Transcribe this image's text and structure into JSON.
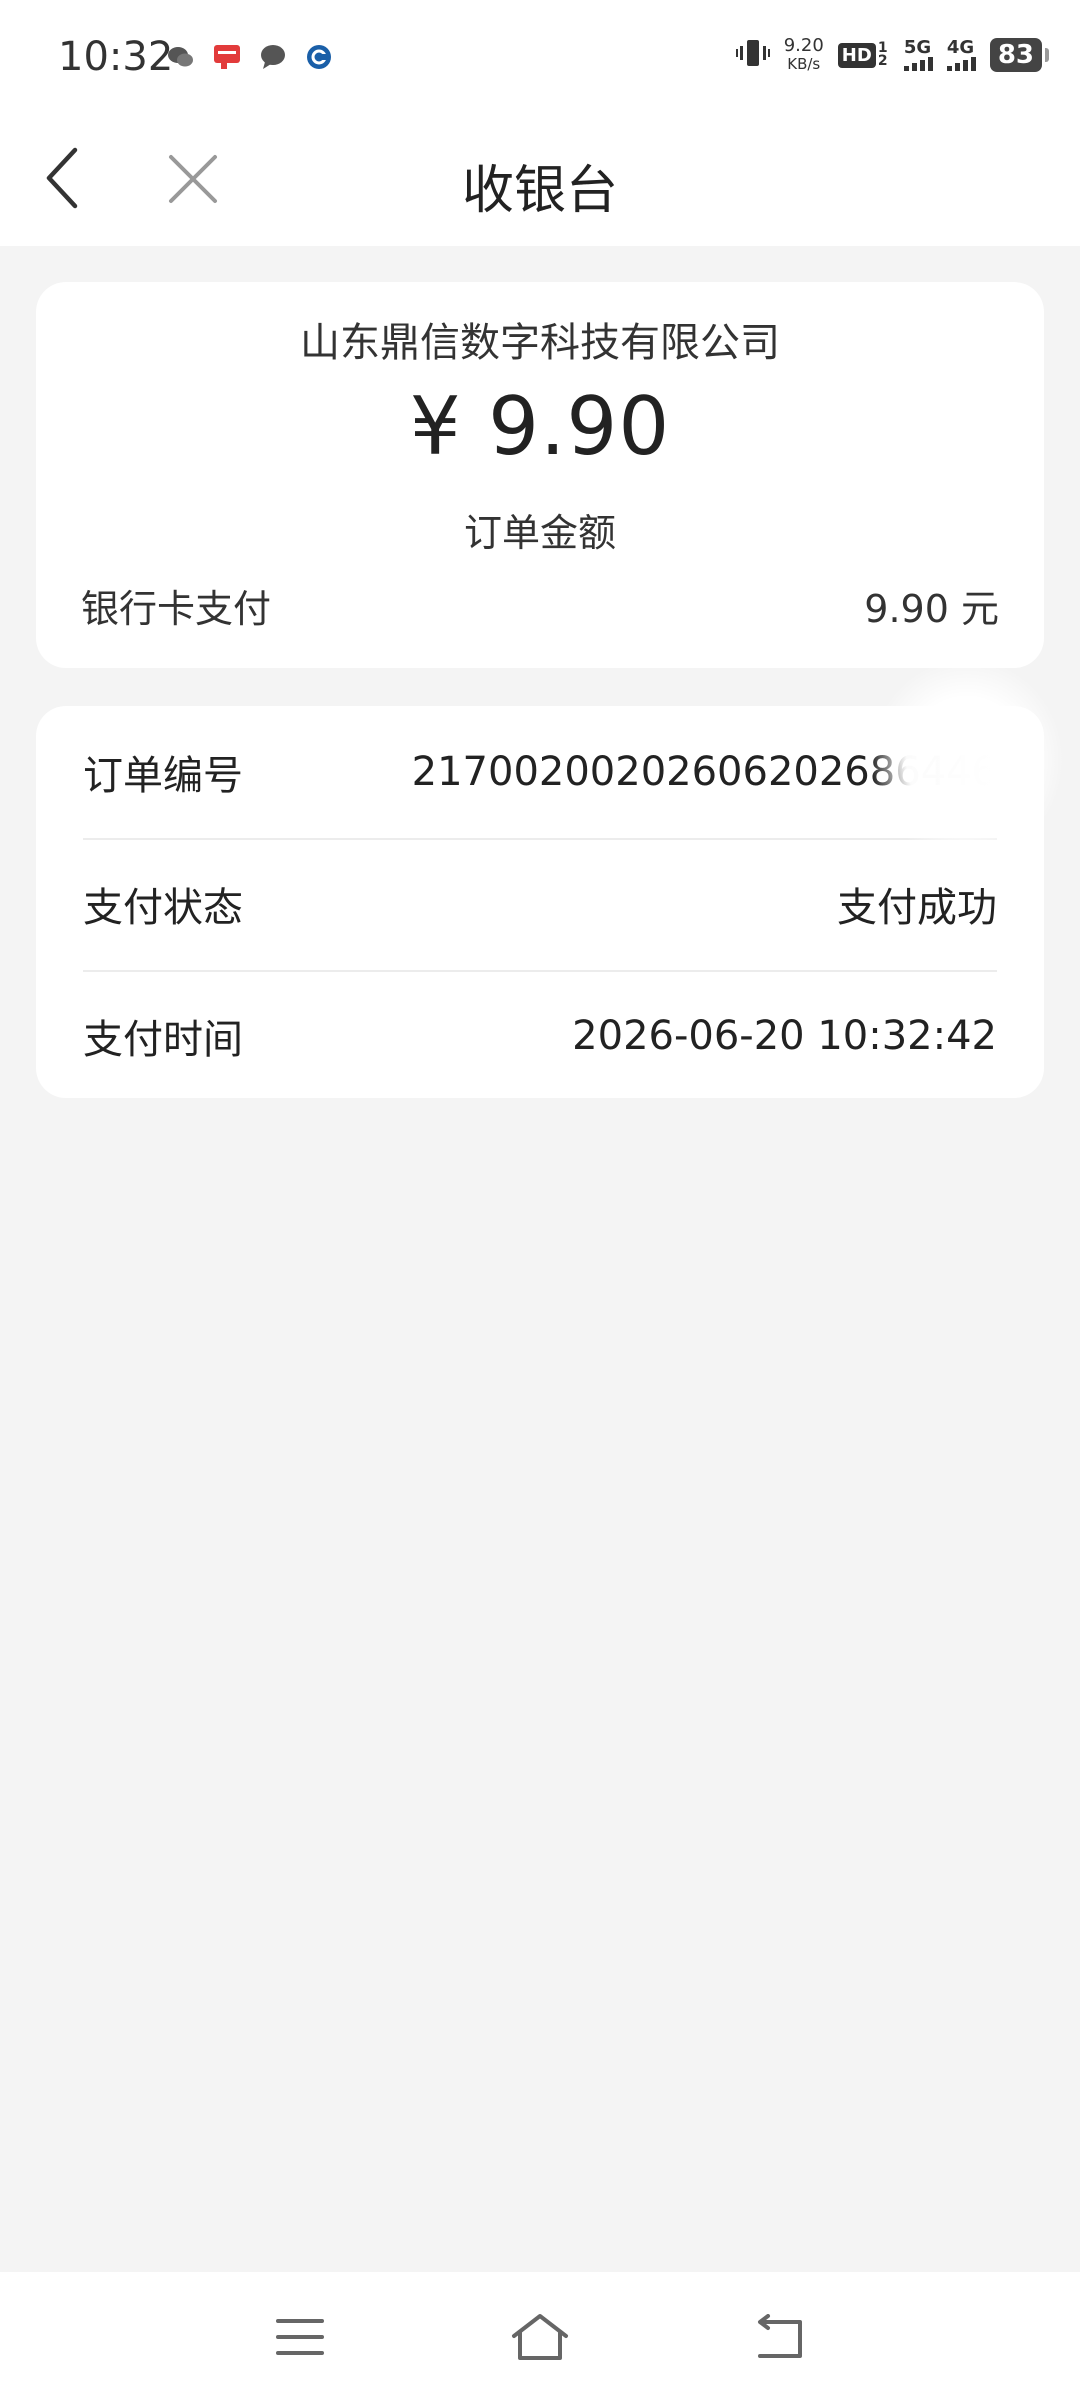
{
  "status_bar": {
    "time": "10:32",
    "net_speed_value": "9.20",
    "net_speed_unit": "KB/s",
    "hd_label": "HD",
    "hd_sub": "1 2",
    "sim1_type": "5G",
    "sim2_type": "4G",
    "battery": "83",
    "notification_icons": [
      "wechat-icon",
      "news-app-icon",
      "message-icon",
      "bank-app-icon"
    ]
  },
  "nav": {
    "title": "收银台"
  },
  "summary": {
    "merchant": "山东鼎信数字科技有限公司",
    "amount": "¥ 9.90",
    "amount_label": "订单金额",
    "pay_method_label": "银行卡支付",
    "pay_method_amount": "9.90 元"
  },
  "details": {
    "order_no_label": "订单编号",
    "order_no_value": "21700200202606202686446",
    "status_label": "支付状态",
    "status_value": "支付成功",
    "time_label": "支付时间",
    "time_value": "2026-06-20 10:32:42"
  },
  "colors": {
    "background": "#f4f4f4",
    "card": "#ffffff",
    "text": "#222222",
    "icon_gray": "#666666"
  }
}
